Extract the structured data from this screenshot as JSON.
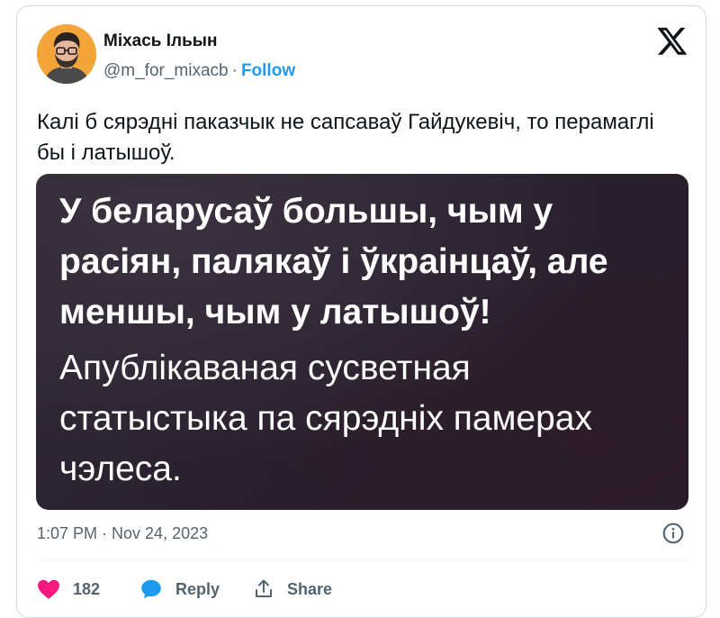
{
  "author": {
    "name": "Міхась Ільын",
    "handle": "@m_for_mixacb",
    "separator": "·",
    "follow_label": "Follow",
    "avatar_color": "#f4a53a"
  },
  "logo": {
    "icon": "x-logo-icon"
  },
  "tweet": {
    "text": "Калі б сярэдні паказчык не сапсаваў Гайдукевіч, то перамаглі бы і латышоў."
  },
  "media": {
    "lines": [
      "У беларусаў большы, чым у",
      "расіян, палякаў і ўкраінцаў, але",
      "меншы, чым у латышоў!",
      "Апублікаваная сусветная",
      "статыстыка па сярэдніх памерах",
      "чэлеса."
    ]
  },
  "meta": {
    "timestamp": "1:07 PM · Nov 24, 2023",
    "info_icon": "info-icon"
  },
  "actions": {
    "like_count": "182",
    "reply_label": "Reply",
    "share_label": "Share"
  },
  "colors": {
    "accent": "#1d9bf0",
    "like": "#f91880",
    "muted_text": "#536471",
    "text": "#0f1419"
  }
}
